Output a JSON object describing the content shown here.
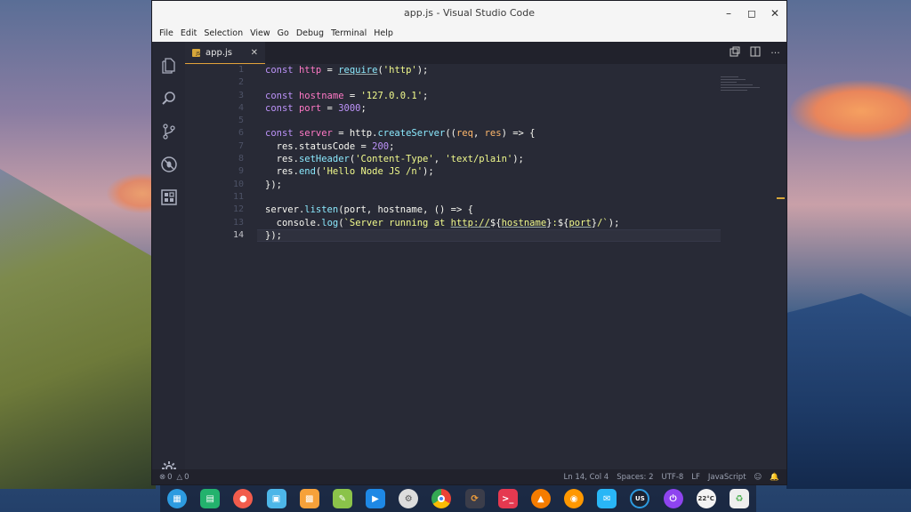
{
  "window": {
    "title": "app.js - Visual Studio Code"
  },
  "menu": [
    "File",
    "Edit",
    "Selection",
    "View",
    "Go",
    "Debug",
    "Terminal",
    "Help"
  ],
  "tab": {
    "label": "app.js",
    "close": "✕"
  },
  "code_lines": [
    "const http = require('http');",
    "",
    "const hostname = '127.0.0.1';",
    "const port = 3000;",
    "",
    "const server = http.createServer((req, res) => {",
    "  res.statusCode = 200;",
    "  res.setHeader('Content-Type', 'text/plain');",
    "  res.end('Hello Node JS /n');",
    "});",
    "",
    "server.listen(port, hostname, () => {",
    "  console.log(`Server running at http://${hostname}:${port}/`);",
    "});"
  ],
  "current_line": 14,
  "status": {
    "errors": "0",
    "warnings": "0",
    "position": "Ln 14, Col 4",
    "spaces": "Spaces: 2",
    "encoding": "UTF-8",
    "eol": "LF",
    "language": "JavaScript"
  },
  "taskbar_items": [
    "launcher",
    "terminal",
    "screenshot",
    "store",
    "archive",
    "editor",
    "video",
    "settings",
    "chrome",
    "vscode",
    "terminal-red",
    "vlc",
    "browser",
    "mail",
    "keyboard-us",
    "power",
    "weather",
    "trash"
  ],
  "taskbar_labels": {
    "keyboard": "US",
    "temp": "22°C"
  },
  "colors": {
    "editor_bg": "#282a36",
    "keyword": "#bd93f9",
    "variable": "#ff79c6",
    "function": "#8be9fd",
    "string": "#f1fa8c",
    "accent": "#e2a33a"
  }
}
